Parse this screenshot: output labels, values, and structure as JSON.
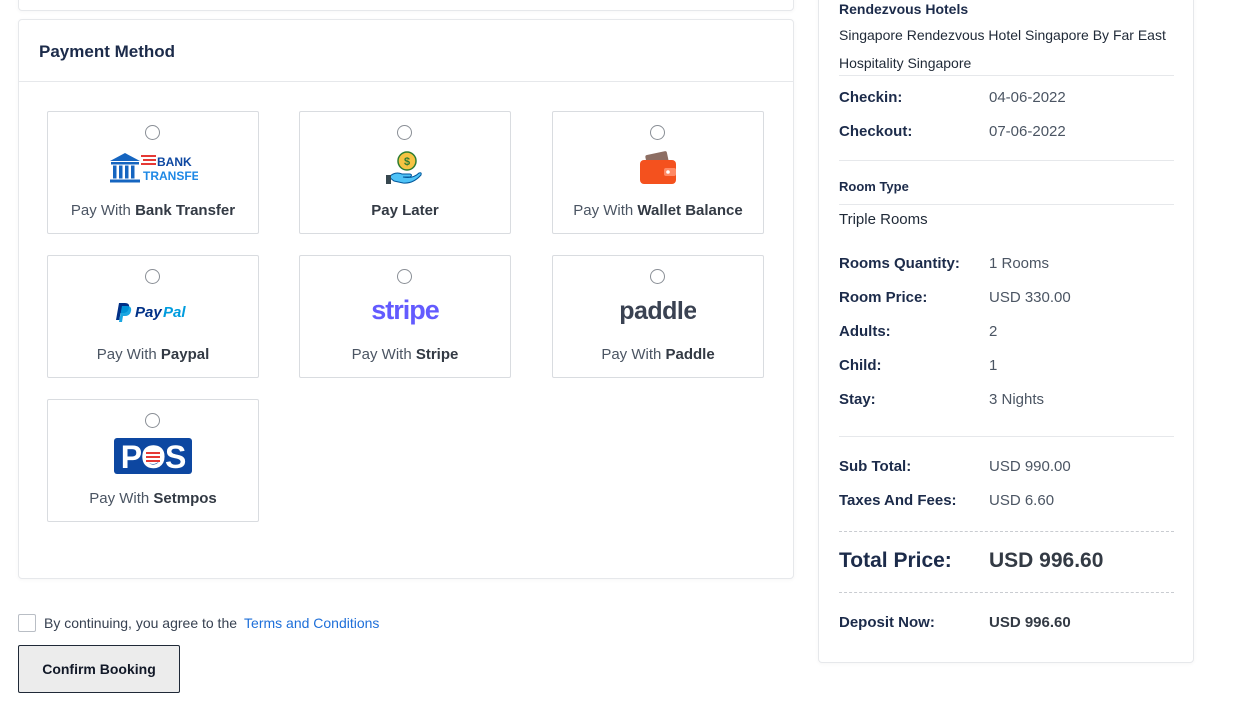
{
  "payment": {
    "title": "Payment Method",
    "options": [
      {
        "prefix": "Pay With",
        "name": "Bank Transfer",
        "logo": "bank-transfer-logo",
        "logo_text_top": "BANK",
        "logo_text_bottom": "TRANSFER",
        "selected": false
      },
      {
        "prefix": "",
        "name": "Pay Later",
        "logo": "pay-later-icon",
        "selected": false
      },
      {
        "prefix": "Pay With",
        "name": "Wallet Balance",
        "logo": "wallet-icon",
        "selected": false
      },
      {
        "prefix": "Pay With",
        "name": "Paypal",
        "logo": "paypal-logo",
        "logo_text": "PayPal",
        "selected": false
      },
      {
        "prefix": "Pay With",
        "name": "Stripe",
        "logo": "stripe-logo",
        "logo_text": "stripe",
        "selected": false
      },
      {
        "prefix": "Pay With",
        "name": "Paddle",
        "logo": "paddle-logo",
        "logo_text": "paddle",
        "selected": false
      },
      {
        "prefix": "Pay With",
        "name": "Setmpos",
        "logo": "pos-logo",
        "logo_text": "POS",
        "selected": false
      }
    ]
  },
  "terms": {
    "text": "By continuing, you agree to the",
    "link": "Terms and Conditions",
    "checked": false
  },
  "confirm_label": "Confirm Booking",
  "summary": {
    "hotel_brand": "Rendezvous Hotels",
    "hotel_name": "Singapore Rendezvous Hotel Singapore By Far East Hospitality Singapore",
    "checkin_label": "Checkin:",
    "checkin_value": "04-06-2022",
    "checkout_label": "Checkout:",
    "checkout_value": "07-06-2022",
    "room_type_label": "Room Type",
    "room_type_value": "Triple Rooms",
    "rooms_qty_label": "Rooms Quantity:",
    "rooms_qty_value": "1 Rooms",
    "room_price_label": "Room Price:",
    "room_price_value": "USD 330.00",
    "adults_label": "Adults:",
    "adults_value": "2",
    "child_label": "Child:",
    "child_value": "1",
    "stay_label": "Stay:",
    "stay_value": "3 Nights",
    "subtotal_label": "Sub Total:",
    "subtotal_value": "USD 990.00",
    "taxes_label": "Taxes And Fees:",
    "taxes_value": "USD 6.60",
    "total_label": "Total Price:",
    "total_value": "USD 996.60",
    "deposit_label": "Deposit Now:",
    "deposit_value": "USD 996.60"
  },
  "colors": {
    "link": "#1e6fd9",
    "heading": "#1c2b4a",
    "bank_blue": "#1565c0",
    "bank_red": "#e53935",
    "wallet_orange": "#f4511e",
    "paypal_dark": "#003087",
    "paypal_light": "#009cde",
    "stripe": "#635bff",
    "paddle": "#3a4252",
    "pos_blue": "#0d47a1"
  }
}
